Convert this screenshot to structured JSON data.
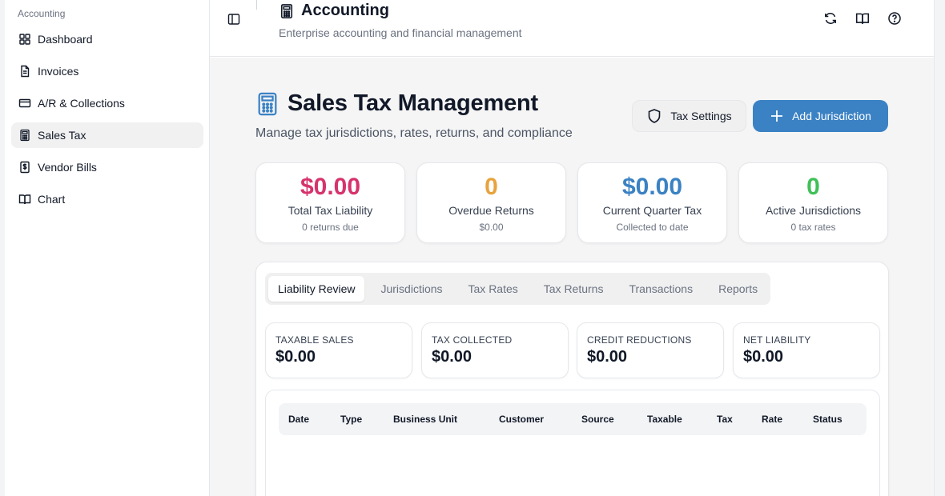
{
  "sidebar": {
    "group_label": "Accounting",
    "items": [
      {
        "label": "Dashboard",
        "icon": "grid-icon",
        "active": false
      },
      {
        "label": "Invoices",
        "icon": "document-icon",
        "active": false
      },
      {
        "label": "A/R & Collections",
        "icon": "credit-card-icon",
        "active": false
      },
      {
        "label": "Sales Tax",
        "icon": "calculator-icon",
        "active": true
      },
      {
        "label": "Vendor Bills",
        "icon": "dollar-receipt-icon",
        "active": false
      },
      {
        "label": "Chart",
        "icon": "book-open-icon",
        "active": false
      }
    ]
  },
  "header": {
    "title": "Accounting",
    "subtitle": "Enterprise accounting and financial management",
    "actions": [
      "refresh-icon",
      "book-open-icon",
      "help-icon"
    ]
  },
  "page": {
    "title": "Sales Tax Management",
    "subtitle": "Manage tax jurisdictions, rates, returns, and compliance",
    "settings_label": "Tax Settings",
    "add_label": "Add Jurisdiction"
  },
  "stats": [
    {
      "value": "$0.00",
      "label": "Total Tax Liability",
      "sub": "0 returns due",
      "color": "#d6336c"
    },
    {
      "value": "0",
      "label": "Overdue Returns",
      "sub": "$0.00",
      "color": "#e8a33d"
    },
    {
      "value": "$0.00",
      "label": "Current Quarter Tax",
      "sub": "Collected to date",
      "color": "#3b82c4"
    },
    {
      "value": "0",
      "label": "Active Jurisdictions",
      "sub": "0 tax rates",
      "color": "#40c057"
    }
  ],
  "tabs": [
    {
      "label": "Liability Review",
      "active": true
    },
    {
      "label": "Jurisdictions",
      "active": false
    },
    {
      "label": "Tax Rates",
      "active": false
    },
    {
      "label": "Tax Returns",
      "active": false
    },
    {
      "label": "Transactions",
      "active": false
    },
    {
      "label": "Reports",
      "active": false
    }
  ],
  "metrics": [
    {
      "label": "TAXABLE SALES",
      "value": "$0.00"
    },
    {
      "label": "TAX COLLECTED",
      "value": "$0.00"
    },
    {
      "label": "CREDIT REDUCTIONS",
      "value": "$0.00"
    },
    {
      "label": "NET LIABILITY",
      "value": "$0.00"
    }
  ],
  "table": {
    "columns": [
      "Date",
      "Type",
      "Business Unit",
      "Customer",
      "Source",
      "Taxable",
      "Tax",
      "Rate",
      "Status"
    ],
    "rows": []
  },
  "colors": {
    "accent": "#3b82c4",
    "liability": "#d6336c",
    "overdue": "#e8a33d",
    "quarter": "#3b82c4",
    "active": "#40c057"
  }
}
